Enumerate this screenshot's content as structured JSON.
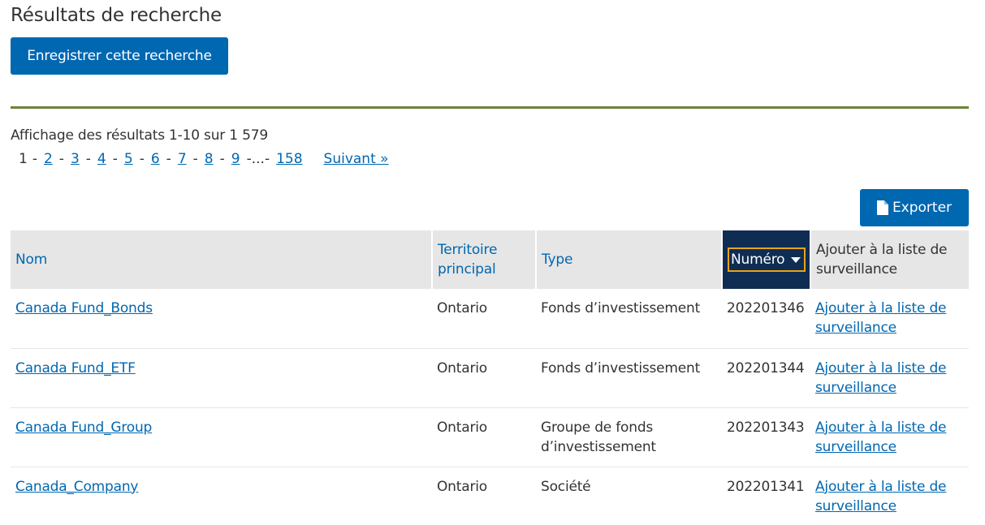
{
  "header": {
    "title": "Résultats de recherche",
    "save_search_label": "Enregistrer cette recherche"
  },
  "results": {
    "summary": "Affichage des résultats 1-10 sur 1 579",
    "pagination": {
      "current": "1",
      "pages": [
        "2",
        "3",
        "4",
        "5",
        "6",
        "7",
        "8",
        "9"
      ],
      "ellipsis": "...",
      "last": "158",
      "next_label": "Suivant »"
    },
    "export_label": "Exporter",
    "export_icon": "file-icon",
    "columns": {
      "name": "Nom",
      "territory": "Territoire principal",
      "type": "Type",
      "number": "Numéro",
      "watchlist": "Ajouter à la liste de surveillance"
    },
    "sort_icon": "caret-down-icon",
    "rows": [
      {
        "name": "Canada Fund_Bonds",
        "territory": "Ontario",
        "type": "Fonds d’investissement",
        "number": "202201346",
        "watchlist": "Ajouter à la liste de surveillance"
      },
      {
        "name": "Canada Fund_ETF",
        "territory": "Ontario",
        "type": "Fonds d’investissement",
        "number": "202201344",
        "watchlist": "Ajouter à la liste de surveillance"
      },
      {
        "name": "Canada Fund_Group",
        "territory": "Ontario",
        "type": "Groupe de fonds d’investissement",
        "number": "202201343",
        "watchlist": "Ajouter à la liste de surveillance"
      },
      {
        "name": "Canada_Company",
        "territory": "Ontario",
        "type": "Société",
        "number": "202201341",
        "watchlist": "Ajouter à la liste de surveillance"
      }
    ]
  },
  "colors": {
    "primary": "#0067b1",
    "sorted_header": "#0f2d52",
    "divider": "#6a8537",
    "focus_outline": "#e8a317"
  }
}
